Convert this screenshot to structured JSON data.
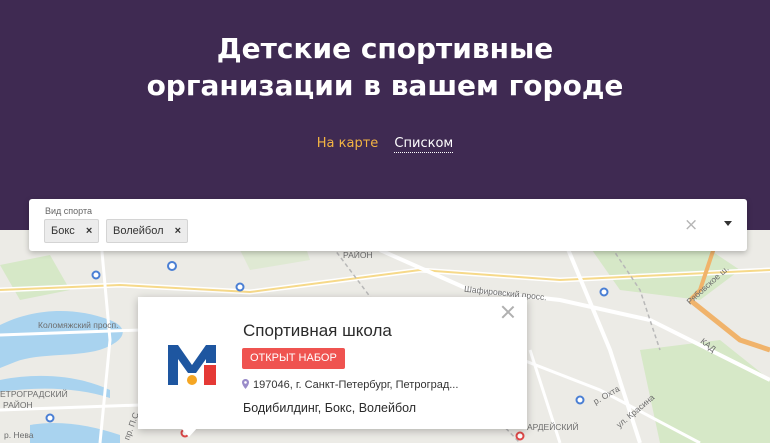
{
  "hero": {
    "title_line1": "Детские спортивные",
    "title_line2": "организации в вашем городе",
    "view_map": "На карте",
    "view_list": "Списком"
  },
  "filter": {
    "label": "Вид спорта",
    "chips": [
      {
        "label": "Бокс",
        "remove": "×"
      },
      {
        "label": "Волейбол",
        "remove": "×"
      }
    ],
    "clear": "×"
  },
  "card": {
    "title": "Спортивная школа",
    "badge": "ОТКРЫТ НАБОР",
    "address": "197046, г. Санкт-Петербург, Петроград...",
    "sports": "Бодибилдинг, Бокс, Волейбол",
    "logo_letter": "M"
  },
  "map_labels": {
    "rayon_top": "РАЙОН",
    "shafirovsky": "Шафировский просс.",
    "sh_road": "Рябовское ш.",
    "kad": "КАД",
    "kolomyazh": "Коломяжский просп.",
    "petrograd_1": "ЕТРОГРАДСКИЙ",
    "petrograd_2": "РАЙОН",
    "okhta": "р. Охта",
    "krasina": "ул. Красина",
    "vardeisky": "АРДЕЙСКИЙ",
    "neva": "р. Нева",
    "ps": "пр. П.С."
  },
  "colors": {
    "hero_bg": "#3f2a52",
    "accent_orange": "#f3b443",
    "badge_red": "#ef5350",
    "logo_blue": "#1e56a0",
    "logo_red": "#e53935",
    "logo_orange": "#f5a623"
  },
  "icons": {
    "pin": "location-pin-icon",
    "close": "close-icon",
    "dropdown": "caret-down-icon"
  }
}
